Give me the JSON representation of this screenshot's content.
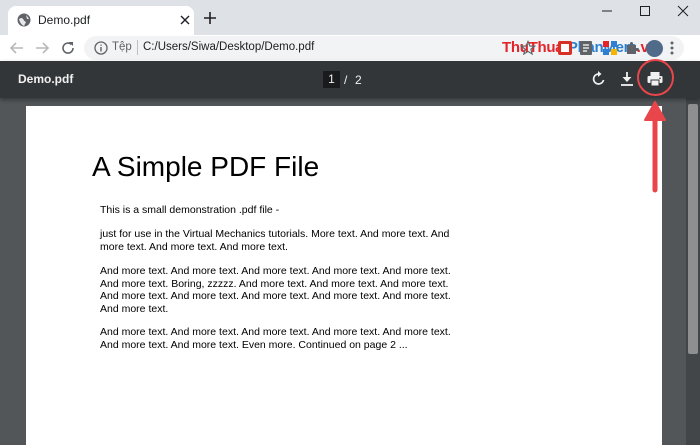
{
  "browser": {
    "tab": {
      "title": "Demo.pdf"
    },
    "window_controls": [
      "minimize",
      "maximize",
      "close"
    ],
    "toolbar": {
      "scheme_label": "Tệp",
      "url": "C:/Users/Siwa/Desktop/Demo.pdf",
      "watermark_part1": "ThuThuat",
      "watermark_part2": "PhanMem",
      "watermark_part3": ".vn"
    }
  },
  "pdf_viewer": {
    "title": "Demo.pdf",
    "current_page": "1",
    "separator": "/",
    "total_pages": "2",
    "buttons": {
      "rotate": "rotate-icon",
      "download": "download-icon",
      "print": "print-icon"
    }
  },
  "document": {
    "heading": "A Simple PDF File",
    "paragraphs": [
      "This is a small demonstration .pdf file -",
      "just for use in the Virtual Mechanics tutorials. More text. And more text. And more text. And more text. And more text.",
      "And more text. And more text. And more text. And more text. And more text. And more text. Boring, zzzzz. And more text. And more text. And more text. And more text. And more text. And more text. And more text. And more text. And more text.",
      "And more text. And more text. And more text. And more text. And more text. And more text. And more text. Even more. Continued on page 2 ..."
    ]
  },
  "annotation": {
    "color": "#e8464b"
  }
}
